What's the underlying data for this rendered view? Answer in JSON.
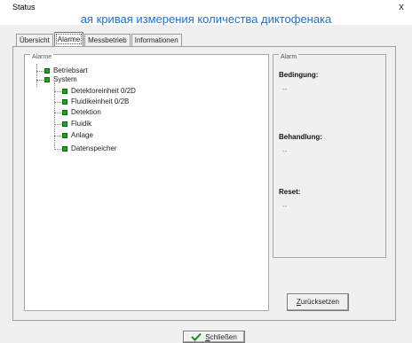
{
  "window": {
    "title": "Status",
    "overlay_caption": "ая кривая измерения количества диктофенака",
    "close_glyph": "x"
  },
  "tabs": [
    {
      "label": "Übersicht",
      "active": false
    },
    {
      "label": "Alarme",
      "active": true
    },
    {
      "label": "Messbetrieb",
      "active": false
    },
    {
      "label": "Informationen",
      "active": false
    }
  ],
  "tree": {
    "legend": "Alarme",
    "items": [
      {
        "label": "Betriebsart",
        "level": 1,
        "status_color": "#1fa11f"
      },
      {
        "label": "System",
        "level": 1,
        "status_color": "#1fa11f"
      },
      {
        "label": "Detektoreinheit 0/2D",
        "level": 2,
        "status_color": "#1fa11f"
      },
      {
        "label": "Fluidikeinheit 0/2B",
        "level": 2,
        "status_color": "#1fa11f"
      },
      {
        "label": "Detektion",
        "level": 2,
        "status_color": "#1fa11f"
      },
      {
        "label": "Fluidik",
        "level": 2,
        "status_color": "#1fa11f"
      },
      {
        "label": "Anlage",
        "level": 2,
        "status_color": "#1fa11f"
      },
      {
        "label": "Datenspeicher",
        "level": 2,
        "status_color": "#1fa11f"
      }
    ]
  },
  "alarm_panel": {
    "legend": "Alarm",
    "condition_label": "Bedingung:",
    "condition_value": "--",
    "treatment_label": "Behandlung:",
    "treatment_value": "--",
    "reset_label": "Reset:",
    "reset_value": "--"
  },
  "buttons": {
    "reset_first": "Z",
    "reset_rest": "urücksetzen",
    "close_first": "S",
    "close_rest": "chließen"
  }
}
